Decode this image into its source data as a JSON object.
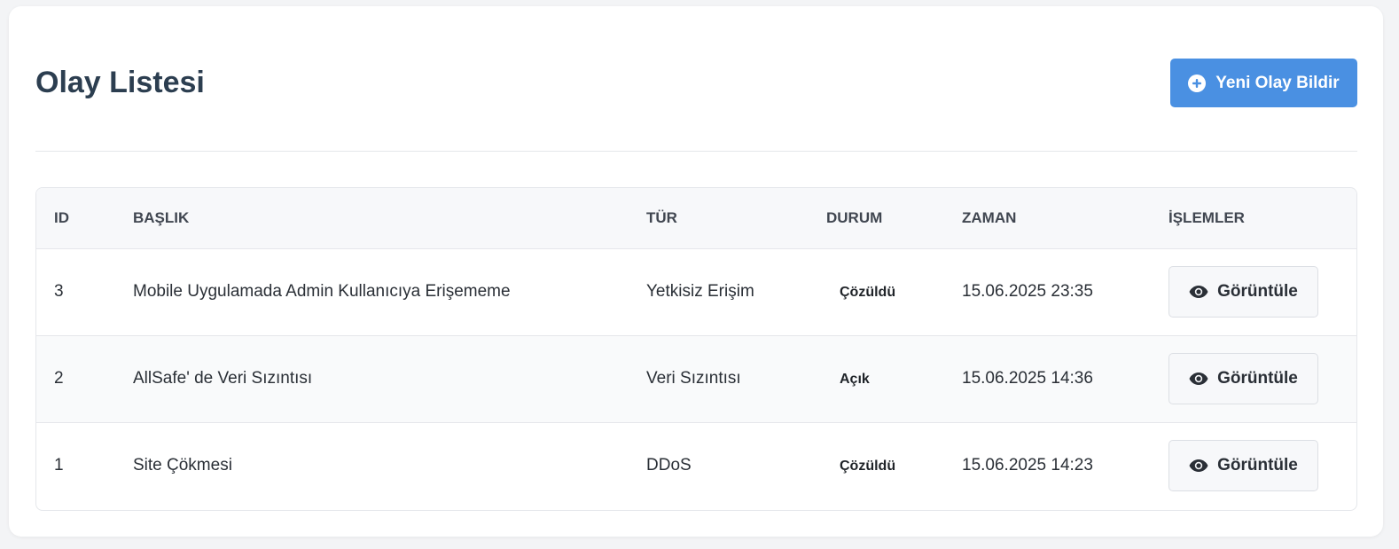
{
  "page": {
    "title": "Olay Listesi",
    "new_button_label": "Yeni Olay Bildir",
    "new_button_icon": "plus-circle-icon",
    "accent_color": "#4a90e2"
  },
  "table": {
    "headers": {
      "id": "ID",
      "title": "BAŞLIK",
      "type": "TÜR",
      "status": "DURUM",
      "time": "ZAMAN",
      "actions": "İŞLEMLER"
    },
    "rows": [
      {
        "id": "3",
        "title": "Mobile Uygulamada Admin Kullanıcıya Erişememe",
        "type": "Yetkisiz Erişim",
        "status": "Çözüldü",
        "time": "15.06.2025 23:35",
        "action_label": "Görüntüle",
        "action_icon": "eye-icon"
      },
      {
        "id": "2",
        "title": "AllSafe' de Veri Sızıntısı",
        "type": "Veri Sızıntısı",
        "status": "Açık",
        "time": "15.06.2025 14:36",
        "action_label": "Görüntüle",
        "action_icon": "eye-icon"
      },
      {
        "id": "1",
        "title": "Site Çökmesi",
        "type": "DDoS",
        "status": "Çözüldü",
        "time": "15.06.2025 14:23",
        "action_label": "Görüntüle",
        "action_icon": "eye-icon"
      }
    ]
  }
}
